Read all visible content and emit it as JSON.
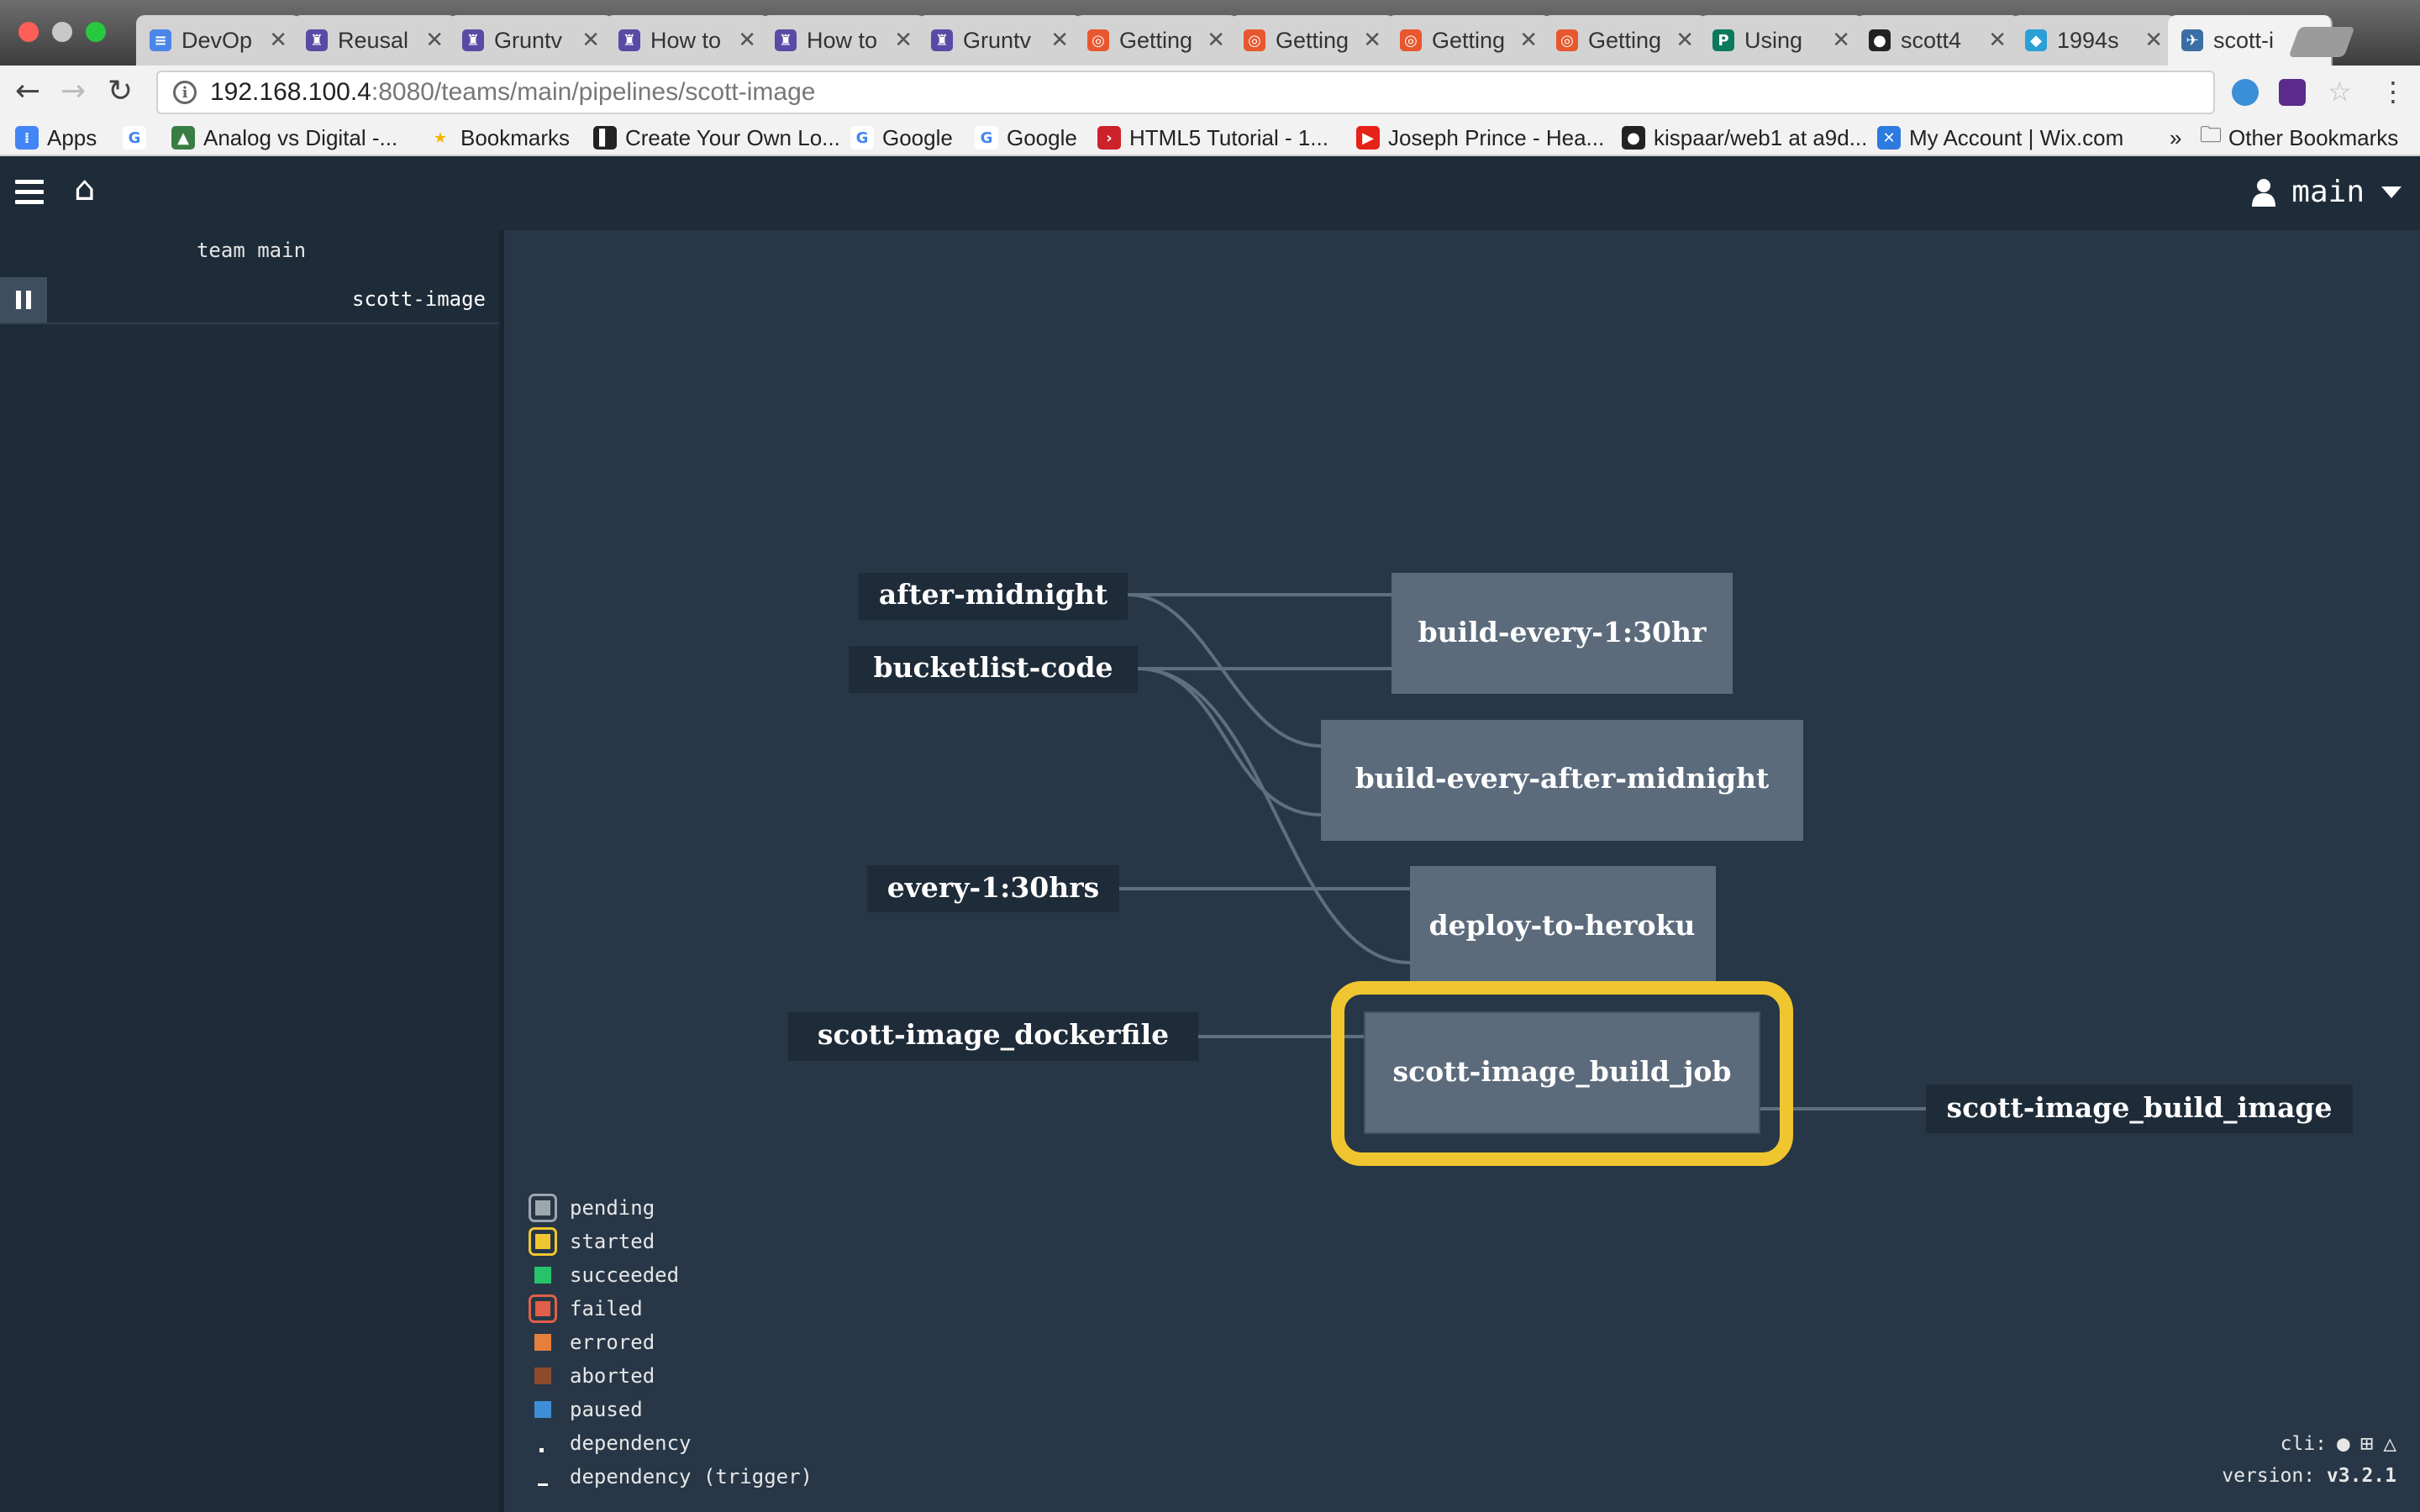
{
  "browser": {
    "tabs": [
      {
        "title": "DevOp",
        "favicon_color": "#4a86e8",
        "favicon_glyph": "≡"
      },
      {
        "title": "Reusal",
        "favicon_color": "#5b4aa5",
        "favicon_glyph": "♜"
      },
      {
        "title": "Gruntv",
        "favicon_color": "#5b4aa5",
        "favicon_glyph": "♜"
      },
      {
        "title": "How to",
        "favicon_color": "#5b4aa5",
        "favicon_glyph": "♜"
      },
      {
        "title": "How to",
        "favicon_color": "#5b4aa5",
        "favicon_glyph": "♜"
      },
      {
        "title": "Gruntv",
        "favicon_color": "#5b4aa5",
        "favicon_glyph": "♜"
      },
      {
        "title": "Getting",
        "favicon_color": "#e8572e",
        "favicon_glyph": "◎"
      },
      {
        "title": "Getting",
        "favicon_color": "#e8572e",
        "favicon_glyph": "◎"
      },
      {
        "title": "Getting",
        "favicon_color": "#e8572e",
        "favicon_glyph": "◎"
      },
      {
        "title": "Getting",
        "favicon_color": "#e8572e",
        "favicon_glyph": "◎"
      },
      {
        "title": "Using",
        "favicon_color": "#0b7a5c",
        "favicon_glyph": "P"
      },
      {
        "title": "scott4",
        "favicon_color": "#222222",
        "favicon_glyph": "●"
      },
      {
        "title": "1994s",
        "favicon_color": "#2aa0d6",
        "favicon_glyph": "◆"
      },
      {
        "title": "scott-i",
        "favicon_color": "#3a6ea5",
        "favicon_glyph": "✈",
        "active": true
      }
    ],
    "tab_close_glyph": "✕",
    "url_host": "192.168.100.4",
    "url_path": ":8080/teams/main/pipelines/scott-image",
    "nav": {
      "back": "←",
      "forward": "→",
      "reload": "↻",
      "info": "i",
      "star": "☆",
      "menu": "⋮"
    },
    "bookmarks": [
      {
        "label": "Apps",
        "icon_color": "#4285f4",
        "icon_glyph": "⁞"
      },
      {
        "label": "",
        "icon_color": "#ffffff",
        "icon_glyph": "G",
        "glyph_color": "#4285f4"
      },
      {
        "label": "Analog vs Digital -...",
        "icon_color": "#3a7d44",
        "icon_glyph": "▲"
      },
      {
        "label": "Bookmarks",
        "icon_color": "#f2f2f2",
        "icon_glyph": "★",
        "glyph_color": "#f4b400"
      },
      {
        "label": "Create Your Own Lo...",
        "icon_color": "#222222",
        "icon_glyph": "▌"
      },
      {
        "label": "Google",
        "icon_color": "#ffffff",
        "icon_glyph": "G",
        "glyph_color": "#4285f4"
      },
      {
        "label": "Google",
        "icon_color": "#ffffff",
        "icon_glyph": "G",
        "glyph_color": "#4285f4"
      },
      {
        "label": "HTML5 Tutorial - 1...",
        "icon_color": "#cc2229",
        "icon_glyph": "›"
      },
      {
        "label": "Joseph Prince - Hea...",
        "icon_color": "#e62117",
        "icon_glyph": "▶"
      },
      {
        "label": "kispaar/web1 at a9d...",
        "icon_color": "#222222",
        "icon_glyph": "●"
      },
      {
        "label": "My Account | Wix.com",
        "icon_color": "#2d7ae0",
        "icon_glyph": "✕"
      }
    ],
    "bookmarks_overflow": "»",
    "other_bookmarks": "Other Bookmarks"
  },
  "app": {
    "user": "main",
    "team_label": "team main",
    "pipeline": "scott-image",
    "resources": {
      "after_midnight": "after-midnight",
      "bucketlist_code": "bucketlist-code",
      "every_130hrs": "every-1:30hrs",
      "dockerfile": "scott-image_dockerfile",
      "build_image": "scott-image_build_image"
    },
    "jobs": {
      "build_every_130hr": "build-every-1:30hr",
      "build_every_after_midnight": "build-every-after-midnight",
      "deploy_to_heroku": "deploy-to-heroku",
      "build_job": "scott-image_build_job"
    },
    "colors": {
      "job_fill": "#5c6b7c",
      "resource_fill": "#1e2b38",
      "started": "#f0c630",
      "edge": "#5f6f7e"
    },
    "legend": [
      {
        "label": "pending",
        "kind": "ring",
        "fill": "#9ea7b0",
        "ring": "#9ea7b0"
      },
      {
        "label": "started",
        "kind": "ring",
        "fill": "#f0c630",
        "ring": "#f0c630"
      },
      {
        "label": "succeeded",
        "kind": "square",
        "fill": "#27c36a"
      },
      {
        "label": "failed",
        "kind": "ring",
        "fill": "#e15f49",
        "ring": "#e15f49"
      },
      {
        "label": "errored",
        "kind": "square",
        "fill": "#e67e3c"
      },
      {
        "label": "aborted",
        "kind": "square",
        "fill": "#8c4b2c"
      },
      {
        "label": "paused",
        "kind": "square",
        "fill": "#3e8fd8"
      },
      {
        "label": "dependency",
        "kind": "dot",
        "fill": "#ffffff"
      },
      {
        "label": "dependency (trigger)",
        "kind": "dash",
        "fill": "#ffffff"
      }
    ],
    "cli_label": "cli:",
    "version_label": "version:",
    "version": "v3.2.1"
  }
}
